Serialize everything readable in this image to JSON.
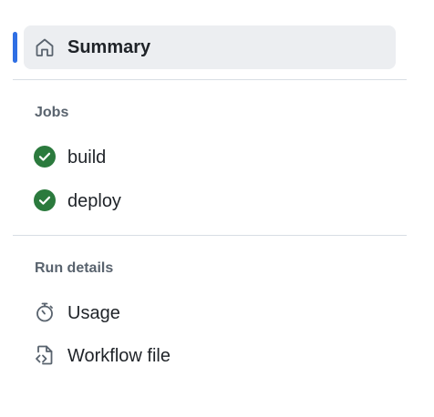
{
  "summary": {
    "label": "Summary",
    "icon": "home-icon",
    "active": true,
    "accent_color": "#2f6fe4"
  },
  "jobs": {
    "title": "Jobs",
    "items": [
      {
        "label": "build",
        "icon": "check-circle-icon",
        "status_color": "#1a7f37"
      },
      {
        "label": "deploy",
        "icon": "check-circle-icon",
        "status_color": "#1a7f37"
      }
    ]
  },
  "run_details": {
    "title": "Run details",
    "items": [
      {
        "label": "Usage",
        "icon": "stopwatch-icon"
      },
      {
        "label": "Workflow file",
        "icon": "file-code-icon"
      }
    ]
  }
}
